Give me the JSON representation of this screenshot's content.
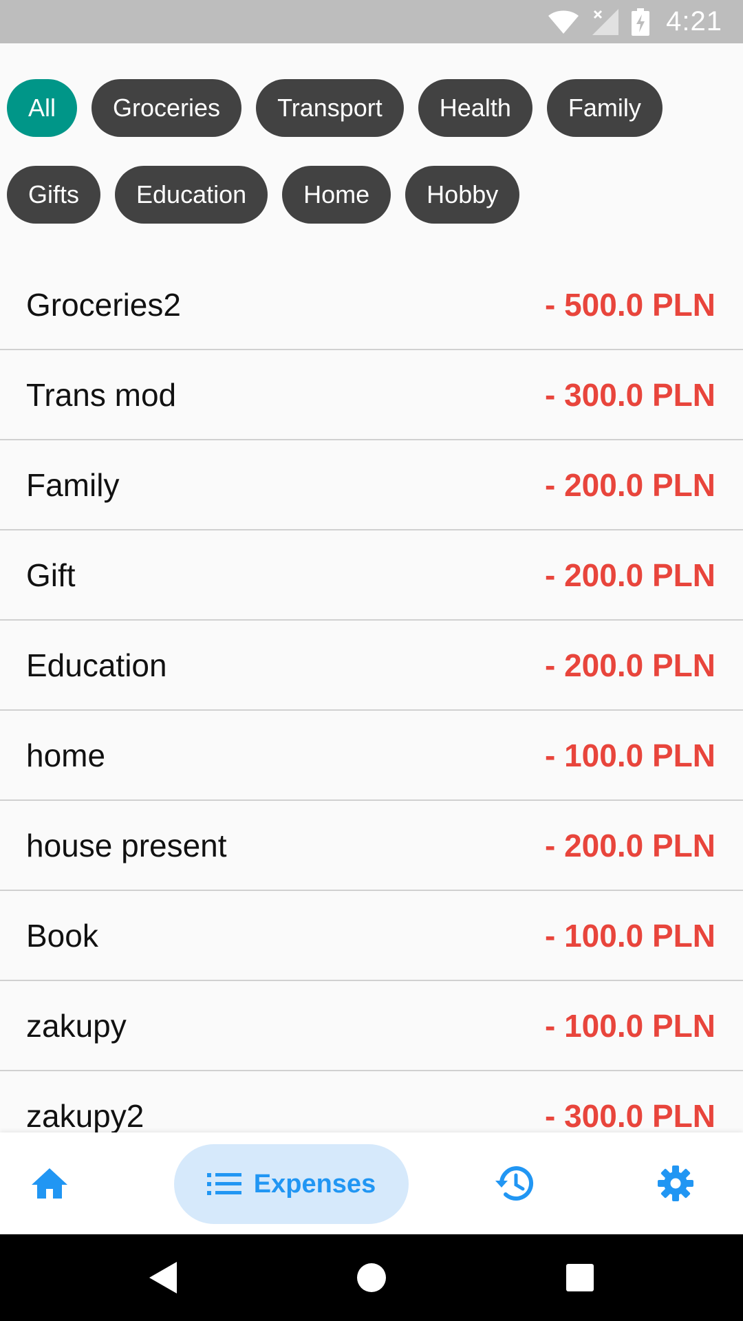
{
  "status_bar": {
    "time": "4:21",
    "icons": [
      "wifi-icon",
      "no-signal-icon",
      "battery-charging-icon"
    ]
  },
  "filters": {
    "selected": "All",
    "chips": [
      "All",
      "Groceries",
      "Transport",
      "Health",
      "Family",
      "Gifts",
      "Education",
      "Home",
      "Hobby"
    ]
  },
  "expenses": [
    {
      "name": "Groceries2",
      "amount": "- 500.0 PLN"
    },
    {
      "name": "Trans mod",
      "amount": "- 300.0 PLN"
    },
    {
      "name": "Family",
      "amount": "- 200.0 PLN"
    },
    {
      "name": "Gift",
      "amount": "- 200.0 PLN"
    },
    {
      "name": "Education",
      "amount": "- 200.0 PLN"
    },
    {
      "name": "home",
      "amount": "- 100.0 PLN"
    },
    {
      "name": "house present",
      "amount": "- 200.0 PLN"
    },
    {
      "name": "Book",
      "amount": "- 100.0 PLN"
    },
    {
      "name": "zakupy",
      "amount": "- 100.0 PLN"
    },
    {
      "name": "zakupy2",
      "amount": "- 300.0 PLN"
    }
  ],
  "bottom_nav": {
    "home_icon": "home-icon",
    "expenses_icon": "list-icon",
    "expenses_label": "Expenses",
    "history_icon": "history-icon",
    "settings_icon": "gear-icon"
  },
  "colors": {
    "accent": "#009688",
    "chip": "#424242",
    "negative_amount": "#e8453c",
    "nav_active": "#2196f3",
    "nav_active_bg": "#d6e9fb"
  }
}
